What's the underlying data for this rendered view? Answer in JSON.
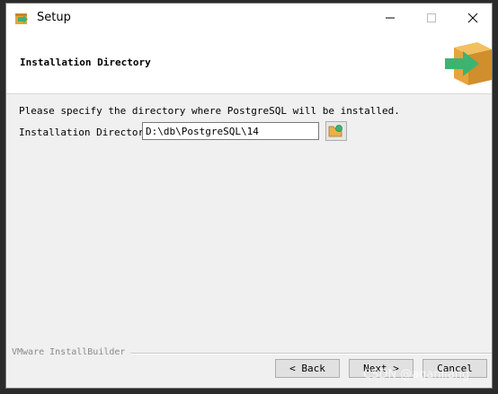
{
  "window": {
    "title": "Setup",
    "buttons": {
      "minimize": "minimize",
      "maximize": "maximize",
      "close": "close"
    }
  },
  "header": {
    "title": "Installation Directory",
    "logo_icon": "installer-box-arrow-icon"
  },
  "content": {
    "description": "Please specify the directory where PostgreSQL will be installed.",
    "directory_label": "Installation Directory",
    "directory_value": "D:\\db\\PostgreSQL\\14",
    "browse_icon": "folder-browse-icon"
  },
  "footer": {
    "brand": "VMware InstallBuilder",
    "back_label": "< Back",
    "next_label": "Next >",
    "cancel_label": "Cancel"
  },
  "watermark": "CSDN @aganliang",
  "colors": {
    "accent_green": "#3cb371",
    "box_orange": "#e8a33c"
  }
}
